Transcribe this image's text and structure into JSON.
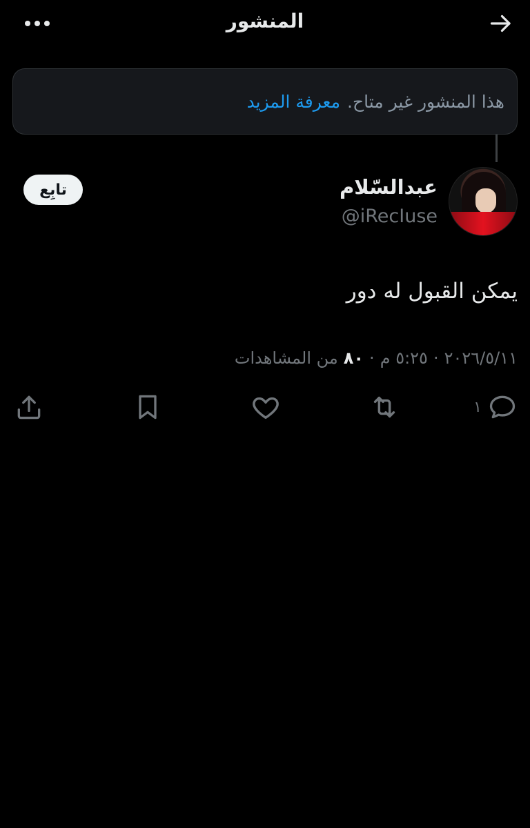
{
  "header": {
    "title": "المنشور",
    "back_icon": "arrow-right-icon",
    "more_icon": "more-horizontal-icon"
  },
  "notice": {
    "text": "هذا المنشور غير متاح.",
    "link_label": "معرفة المزيد"
  },
  "post": {
    "author_name": "عبدالسّلام",
    "author_handle": "@iRecIuse",
    "follow_label": "تابِع",
    "text": "يمكن القبول له دور",
    "date": "٢٠٢٦/٥/١١",
    "separator": "·",
    "time": "٥:٢٥ م",
    "views_count": "٨٠",
    "views_label": "من المشاهدات"
  },
  "actions": {
    "reply_count": "١",
    "icons": [
      "reply-icon",
      "retweet-icon",
      "like-icon",
      "bookmark-icon",
      "share-icon"
    ]
  },
  "colors": {
    "background": "#000000",
    "text_primary": "#e7e9ea",
    "text_secondary": "#71767b",
    "link": "#1d9bf0",
    "notice_bg": "#16181c"
  }
}
